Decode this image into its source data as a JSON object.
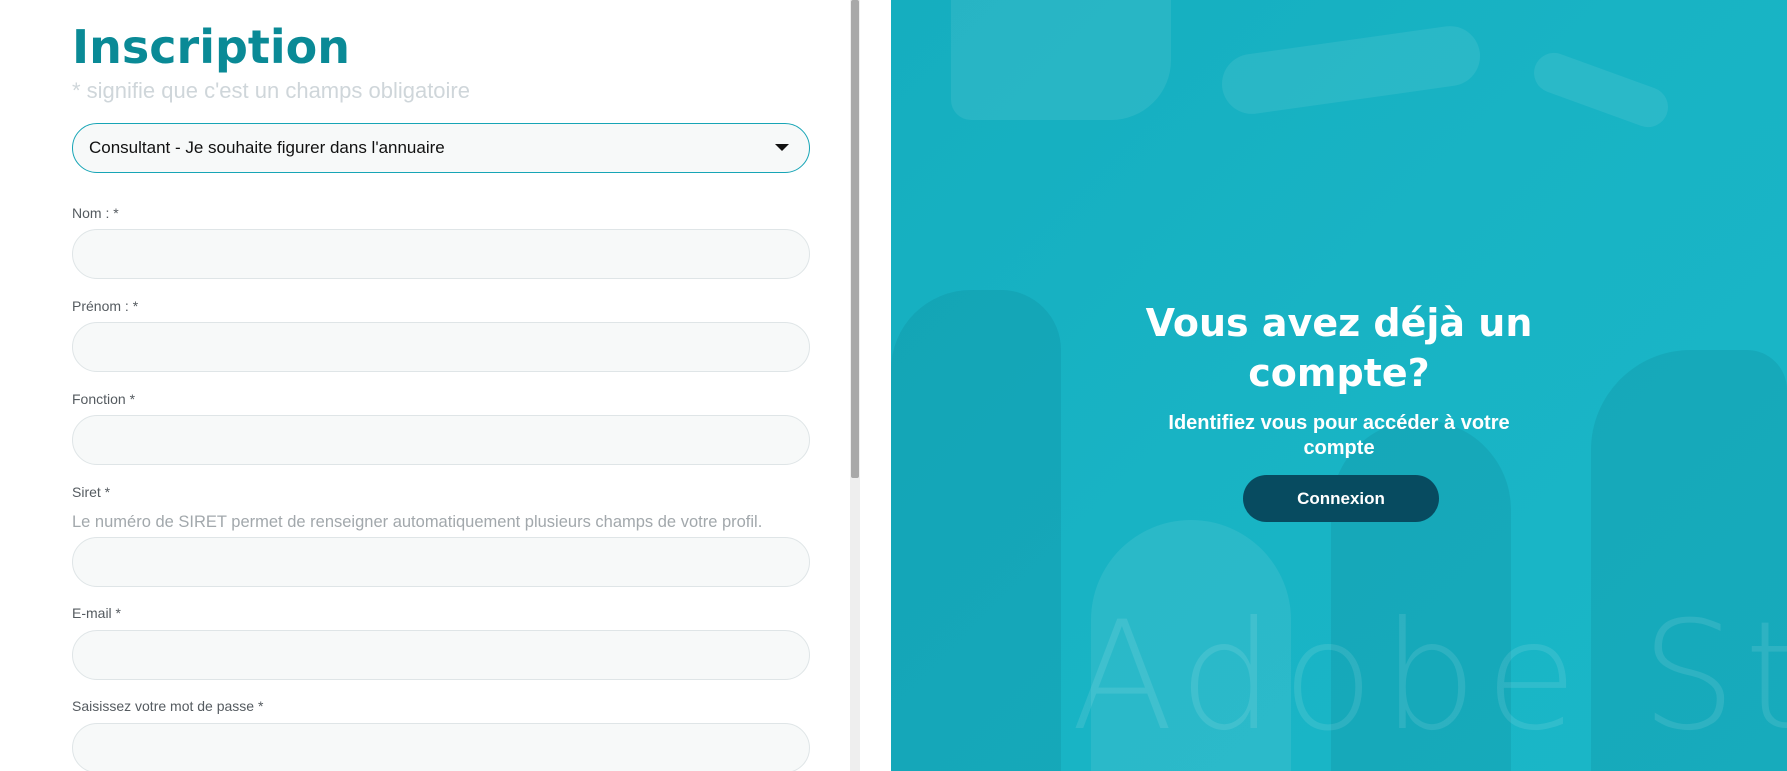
{
  "form": {
    "title": "Inscription",
    "subtitle": "* signifie que c'est un champs obligatoire",
    "account_type": {
      "selected": "Consultant - Je souhaite figurer dans l'annuaire"
    },
    "fields": {
      "nom": {
        "label": "Nom : *",
        "value": ""
      },
      "prenom": {
        "label": "Prénom : *",
        "value": ""
      },
      "fonction": {
        "label": "Fonction *",
        "value": ""
      },
      "siret": {
        "label": "Siret *",
        "hint": "Le numéro de SIRET permet de renseigner automatiquement plusieurs champs de votre profil.",
        "value": ""
      },
      "email": {
        "label": "E-mail *",
        "value": ""
      },
      "password": {
        "label": "Saisissez votre mot de passe *",
        "value": ""
      }
    }
  },
  "hero": {
    "title": "Vous avez déjà un compte?",
    "subtitle": "Identifiez vous pour accéder à votre compte",
    "login_label": "Connexion",
    "watermark": "Adobe St"
  },
  "colors": {
    "brand_teal": "#0a8a96",
    "hero_bg": "#18b3c4",
    "button_dark": "#074b60",
    "select_border": "#17a5b6"
  },
  "icons": {
    "select_caret": "caret-down-icon"
  }
}
